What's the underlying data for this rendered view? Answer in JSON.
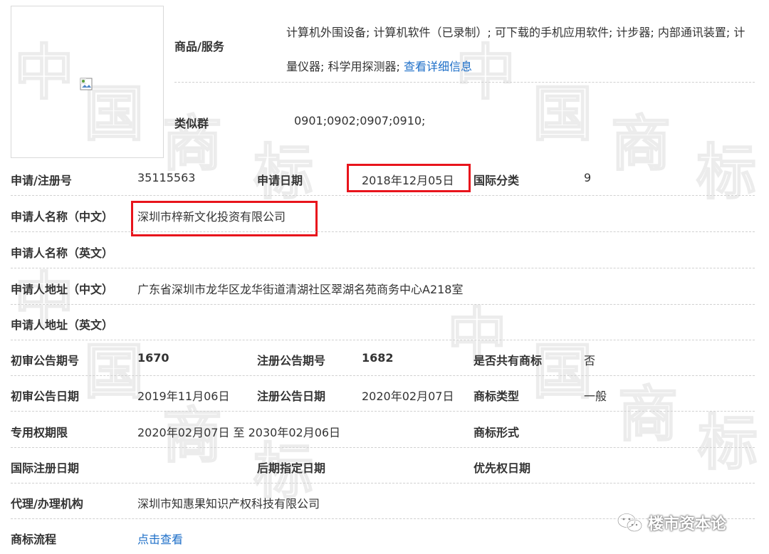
{
  "watermark": {
    "chars": [
      "中",
      "国",
      "商",
      "标"
    ]
  },
  "goods": {
    "label": "商品/服务",
    "text": "计算机外围设备; 计算机软件（已录制）; 可下载的手机应用软件; 计步器; 内部通讯装置; 计量仪器; 科学用探测器;",
    "detail_link": "查看详细信息"
  },
  "similar_group": {
    "label": "类似群",
    "value": "0901;0902;0907;0910;"
  },
  "reg": {
    "reg_no_label": "申请/注册号",
    "reg_no": "35115563",
    "date_label": "申请日期",
    "date": "2018年12月05日",
    "class_label": "国际分类",
    "class": "9"
  },
  "applicant_cn": {
    "label": "申请人名称（中文）",
    "value": "深圳市梓新文化投资有限公司"
  },
  "applicant_en": {
    "label": "申请人名称（英文）",
    "value": ""
  },
  "address_cn": {
    "label": "申请人地址（中文）",
    "value": "广东省深圳市龙华区龙华街道清湖社区翠湖名苑商务中心A218室"
  },
  "address_en": {
    "label": "申请人地址（英文）",
    "value": ""
  },
  "announce": {
    "prelim_no_label": "初审公告期号",
    "prelim_no": "1670",
    "reg_no_label": "注册公告期号",
    "reg_no": "1682",
    "shared_label": "是否共有商标",
    "shared": "否"
  },
  "announce_date": {
    "prelim_date_label": "初审公告日期",
    "prelim_date": "2019年11月06日",
    "reg_date_label": "注册公告日期",
    "reg_date": "2020年02月07日",
    "type_label": "商标类型",
    "type": "一般"
  },
  "term": {
    "label": "专用权期限",
    "value": "2020年02月07日 至 2030年02月06日",
    "form_label": "商标形式"
  },
  "intl": {
    "intl_date_label": "国际注册日期",
    "later_label": "后期指定日期",
    "priority_label": "优先权日期"
  },
  "agent": {
    "label": "代理/办理机构",
    "value": "深圳市知惠果知识产权科技有限公司"
  },
  "flow": {
    "label": "商标流程",
    "link": "点击查看"
  },
  "brand": {
    "name": "楼市资本论"
  }
}
